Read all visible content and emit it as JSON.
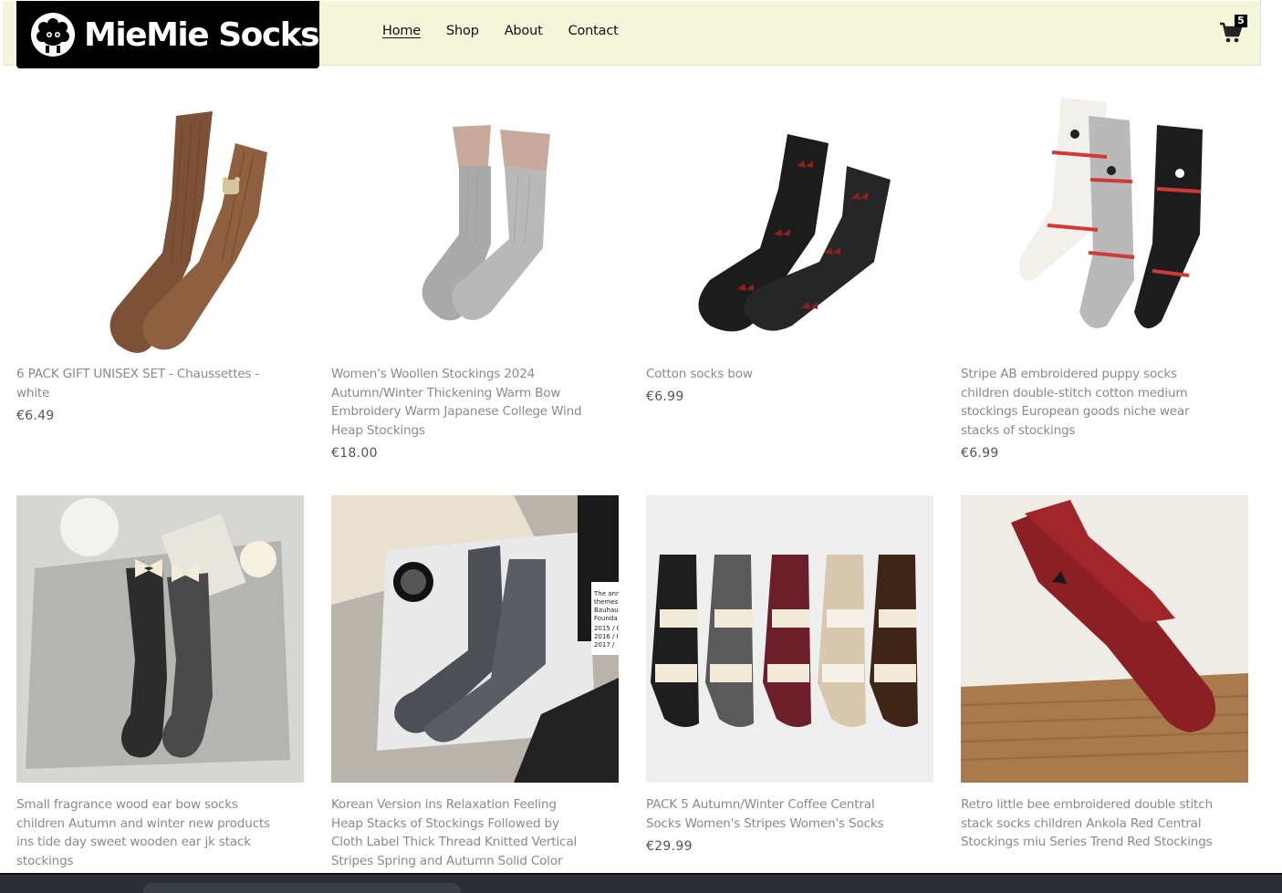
{
  "brand": {
    "name": "MieMie Socks"
  },
  "nav": {
    "items": [
      {
        "label": "Home",
        "active": true
      },
      {
        "label": "Shop",
        "active": false
      },
      {
        "label": "About",
        "active": false
      },
      {
        "label": "Contact",
        "active": false
      }
    ]
  },
  "cart": {
    "count": "5"
  },
  "products": [
    {
      "name": "6 PACK GIFT UNISEX SET - Chaussettes - white",
      "price": "€6.49"
    },
    {
      "name": "Women's Woollen Stockings 2024 Autumn/Winter Thickening Warm Bow Embroidery Warm Japanese College Wind Heap Stockings",
      "price": "€18.00"
    },
    {
      "name": "Cotton socks bow",
      "price": "€6.99"
    },
    {
      "name": "Stripe AB embroidered puppy socks children double-stitch cotton medium stockings European goods niche wear stacks of stockings",
      "price": "€6.99"
    },
    {
      "name": "Small fragrance wood ear bow socks children Autumn and winter new products ins tide day sweet wooden ear jk stack stockings",
      "price": ""
    },
    {
      "name": "Korean Version ins Relaxation Feeling Heap Stacks of Stockings Followed by Cloth Label Thick Thread Knitted Vertical Stripes Spring and Autumn Solid Color",
      "price": ""
    },
    {
      "name": "PACK 5 Autumn/Winter Coffee Central Socks Women's Stripes Women's Socks",
      "price": "€29.99"
    },
    {
      "name": "Retro little bee embroidered double stitch stack socks children Ankola Red Central Stockings miu Series Trend Red Stockings",
      "price": ""
    }
  ],
  "product_image_text": {
    "card_lines": [
      "The annu",
      "themes",
      "Bauhau",
      "Founda",
      "2015 / C",
      "2016 / I",
      "2017 / "
    ]
  }
}
